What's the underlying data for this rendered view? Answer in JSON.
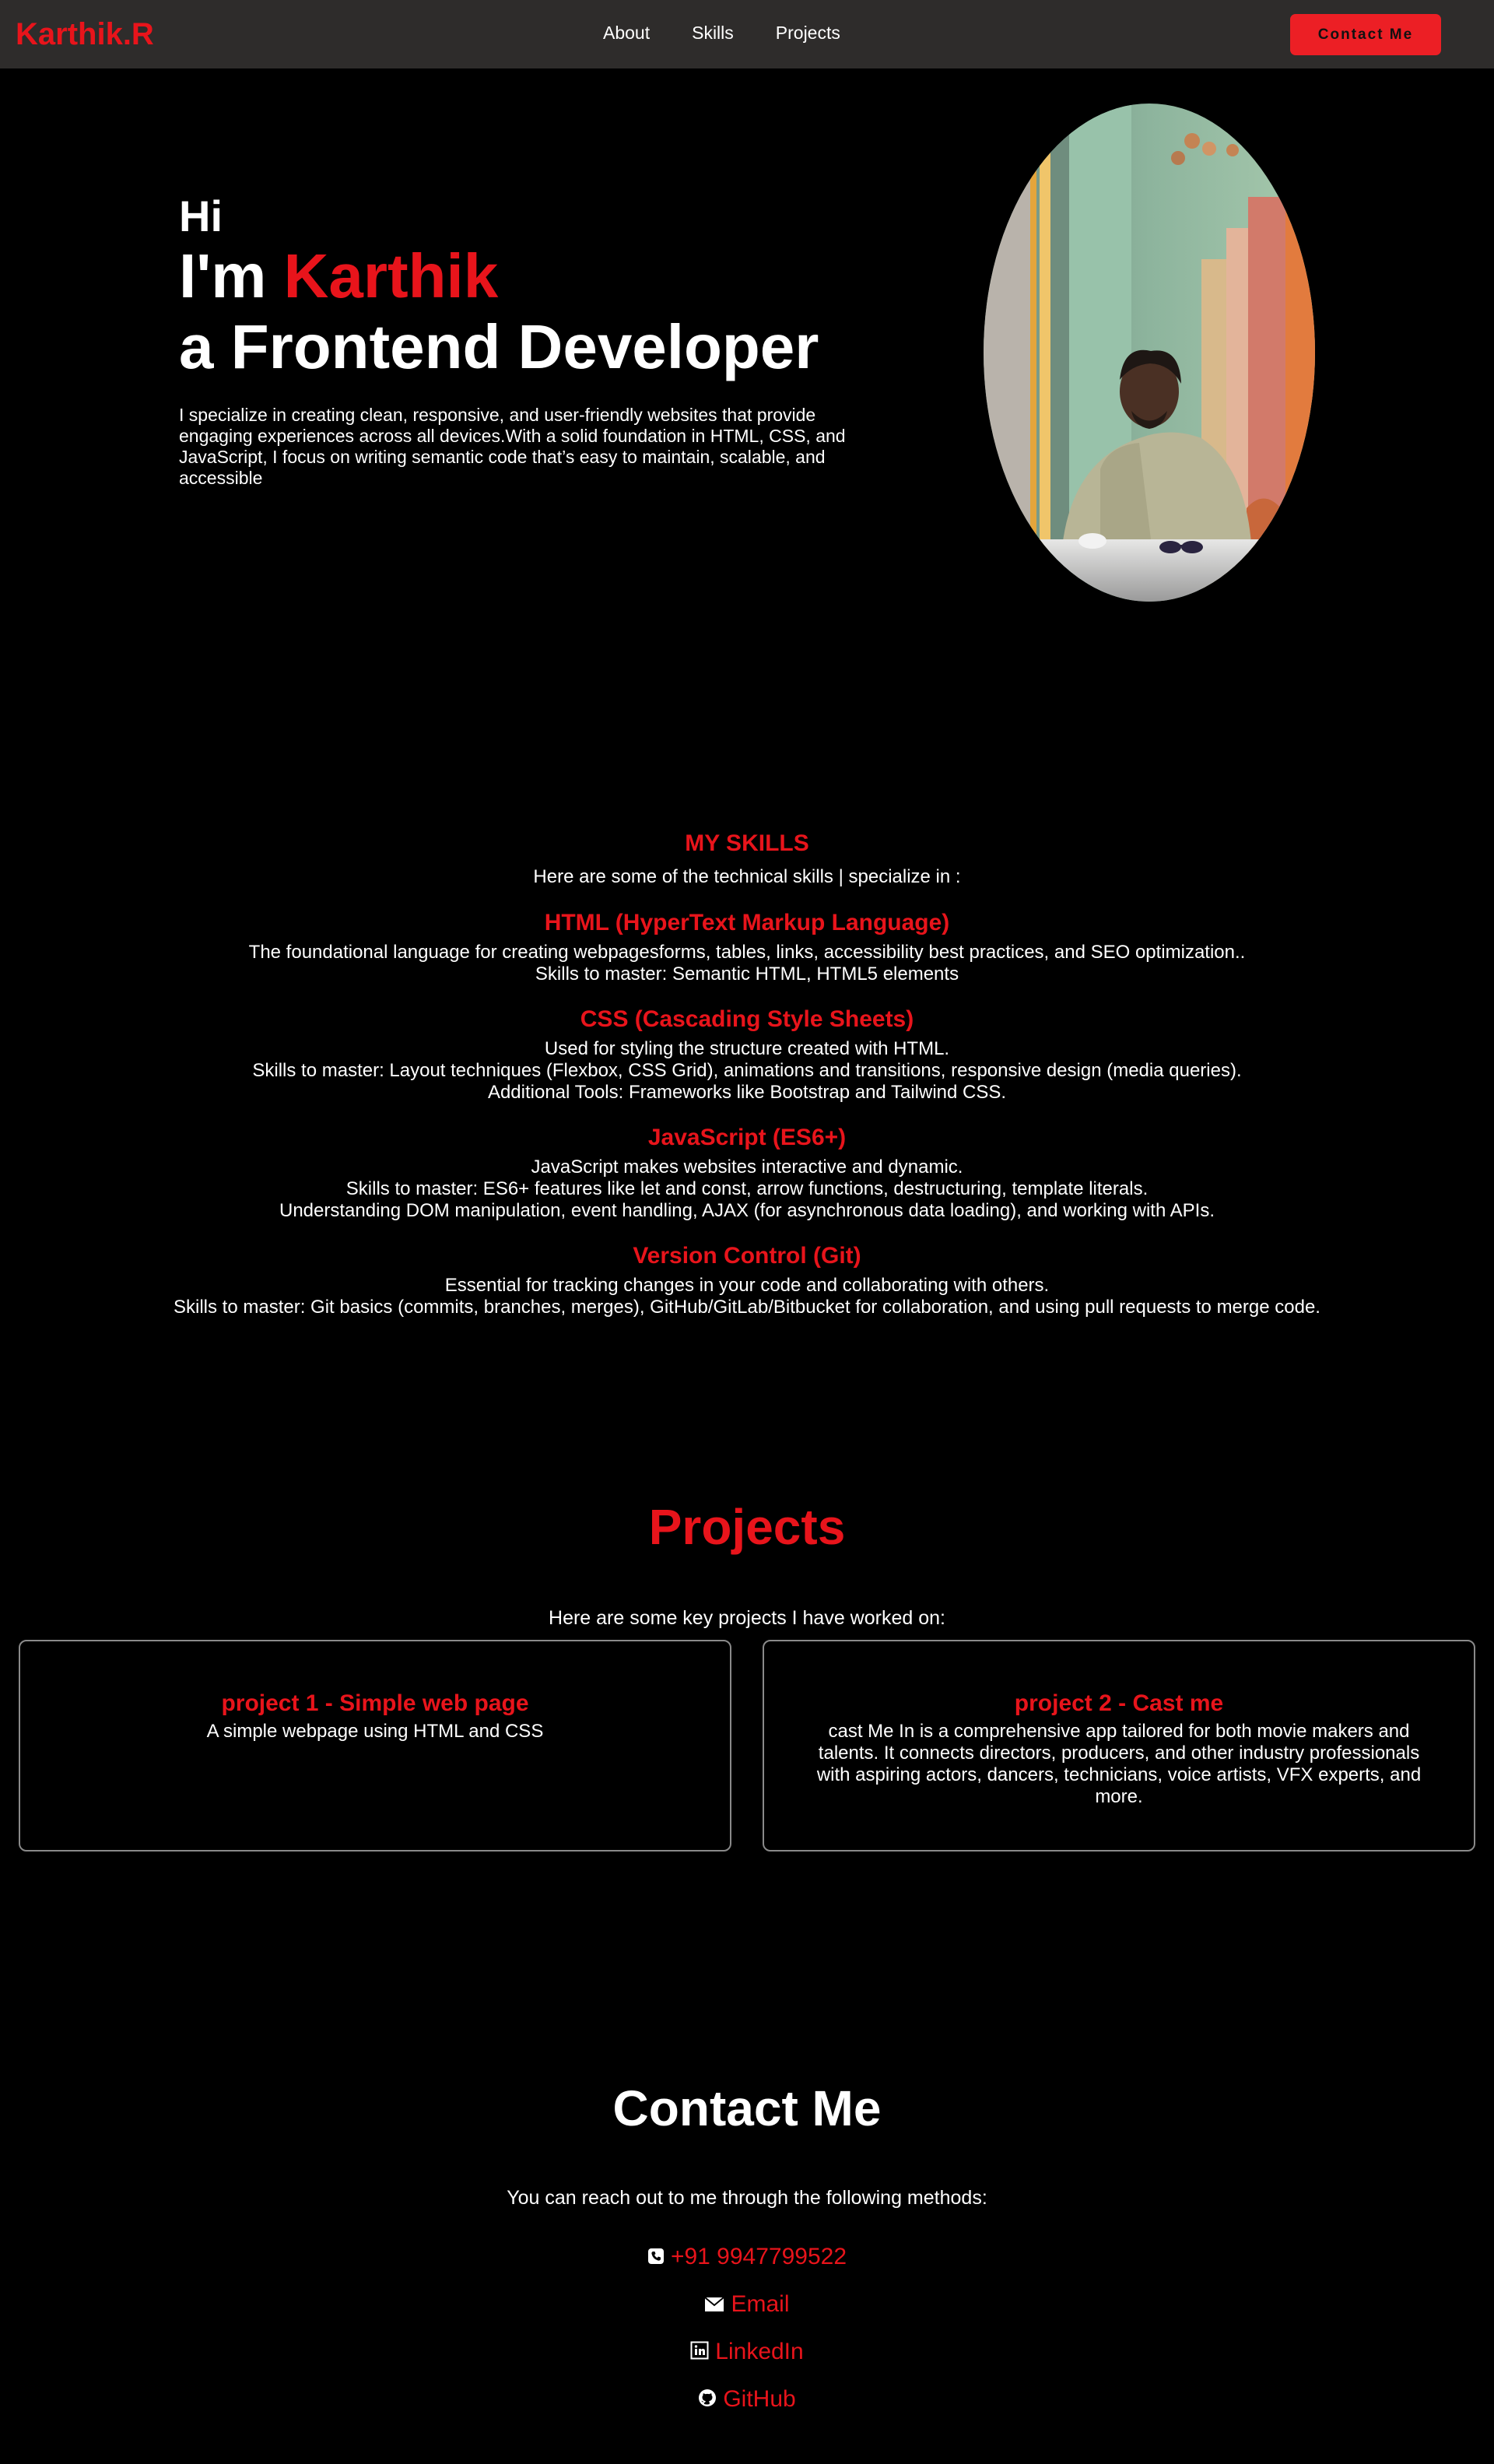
{
  "nav": {
    "logo": "Karthik.R",
    "links": [
      "About",
      "Skills",
      "Projects"
    ],
    "cta": "Contact Me"
  },
  "hero": {
    "greeting": "Hi",
    "intro_prefix": "I'm ",
    "name": "Karthik",
    "role": "a Frontend Developer",
    "description": "I specialize in creating clean, responsive, and user-friendly websites that provide engaging experiences across all devices.With a solid foundation in HTML, CSS, and JavaScript, I focus on writing semantic code that’s easy to maintain, scalable, and accessible"
  },
  "skills": {
    "title": "MY SKILLS",
    "subtitle": "Here are some of the technical skills | specialize in :",
    "items": [
      {
        "title": "HTML (HyperText Markup Language)",
        "lines": [
          "The foundational language for creating webpagesforms, tables, links, accessibility best practices, and SEO optimization..",
          "Skills to master: Semantic HTML, HTML5 elements"
        ]
      },
      {
        "title": "CSS (Cascading Style Sheets)",
        "lines": [
          "Used for styling the structure created with HTML.",
          "Skills to master: Layout techniques (Flexbox, CSS Grid), animations and transitions, responsive design (media queries).",
          "Additional Tools: Frameworks like Bootstrap and Tailwind CSS."
        ]
      },
      {
        "title": "JavaScript (ES6+)",
        "lines": [
          "JavaScript makes websites interactive and dynamic.",
          "Skills to master: ES6+ features like let and const, arrow functions, destructuring, template literals.",
          "Understanding DOM manipulation, event handling, AJAX (for asynchronous data loading), and working with APIs."
        ]
      },
      {
        "title": "Version Control (Git)",
        "lines": [
          "Essential for tracking changes in your code and collaborating with others.",
          "Skills to master: Git basics (commits, branches, merges), GitHub/GitLab/Bitbucket for collaboration, and using pull requests to merge code."
        ]
      }
    ]
  },
  "projects": {
    "title": "Projects",
    "subtitle": "Here are some key projects I have worked on:",
    "items": [
      {
        "title": "project 1 - Simple web page",
        "description": "A simple webpage using HTML and CSS"
      },
      {
        "title": "project 2 - Cast me",
        "description": "cast Me In is a comprehensive app tailored for both movie makers and talents. It connects directors, producers, and other industry professionals with aspiring actors, dancers, technicians, voice artists, VFX experts, and more."
      }
    ]
  },
  "contact": {
    "title": "Contact Me",
    "subtitle": "You can reach out to me through the following methods:",
    "phone": "+91 9947799522",
    "email": "Email",
    "linkedin": "LinkedIn",
    "github": "GitHub",
    "icons": [
      "phone-icon",
      "mail-icon",
      "linkedin-icon",
      "github-icon"
    ]
  },
  "colors": {
    "accent": "#e8141b",
    "nav_bg": "#2e2c2b",
    "button": "#ec1f25"
  }
}
